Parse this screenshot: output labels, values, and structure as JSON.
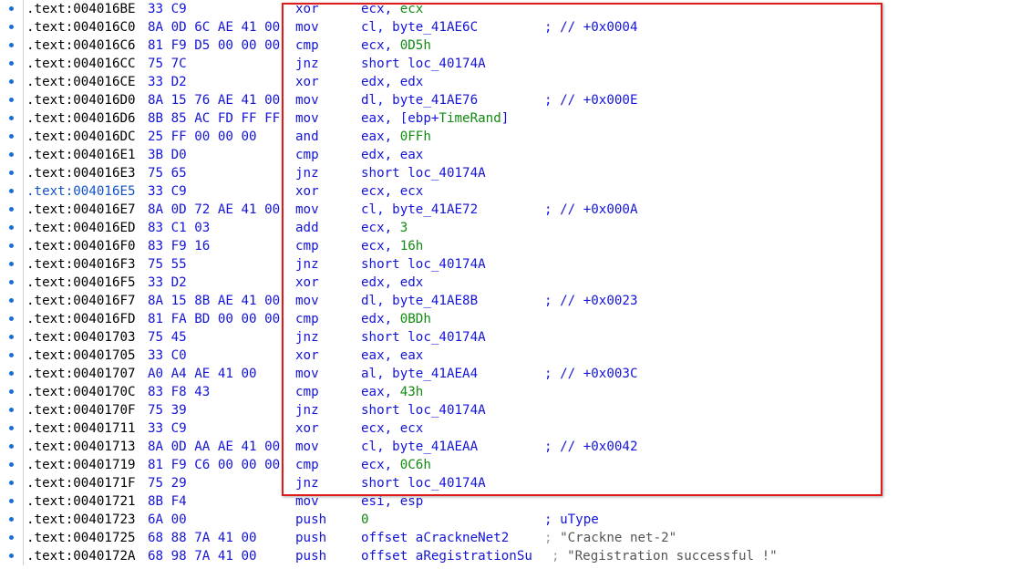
{
  "rows": [
    {
      "addr": ".text:004016BE",
      "bytes": "33 C9",
      "mnem": "xor",
      "op1": "ecx, ",
      "op2": "ecx",
      "cmt": ""
    },
    {
      "addr": ".text:004016C0",
      "bytes": "8A 0D 6C AE 41 00",
      "mnem": "mov",
      "op1": "cl, byte_41AE6C",
      "op2": "",
      "cmt": "; // +0x0004"
    },
    {
      "addr": ".text:004016C6",
      "bytes": "81 F9 D5 00 00 00",
      "mnem": "cmp",
      "op1": "ecx, ",
      "op2": "0D5h",
      "cmt": ""
    },
    {
      "addr": ".text:004016CC",
      "bytes": "75 7C",
      "mnem": "jnz",
      "op1": "short loc_40174A",
      "op2": "",
      "cmt": ""
    },
    {
      "addr": ".text:004016CE",
      "bytes": "33 D2",
      "mnem": "xor",
      "op1": "edx, edx",
      "op2": "",
      "cmt": ""
    },
    {
      "addr": ".text:004016D0",
      "bytes": "8A 15 76 AE 41 00",
      "mnem": "mov",
      "op1": "dl, byte_41AE76",
      "op2": "",
      "cmt": "; // +0x000E"
    },
    {
      "addr": ".text:004016D6",
      "bytes": "8B 85 AC FD FF FF",
      "mnem": "mov",
      "op1": "eax, [ebp+",
      "op2": "TimeRand",
      "op3": "]",
      "cmt": ""
    },
    {
      "addr": ".text:004016DC",
      "bytes": "25 FF 00 00 00",
      "mnem": "and",
      "op1": "eax, ",
      "op2": "0FFh",
      "cmt": ""
    },
    {
      "addr": ".text:004016E1",
      "bytes": "3B D0",
      "mnem": "cmp",
      "op1": "edx, eax",
      "op2": "",
      "cmt": ""
    },
    {
      "addr": ".text:004016E3",
      "bytes": "75 65",
      "mnem": "jnz",
      "op1": "short loc_40174A",
      "op2": "",
      "cmt": ""
    },
    {
      "addr": ".text:004016E5",
      "bytes": "33 C9",
      "mnem": "xor",
      "op1": "ecx, ecx",
      "op2": "",
      "cmt": "",
      "alt": true
    },
    {
      "addr": ".text:004016E7",
      "bytes": "8A 0D 72 AE 41 00",
      "mnem": "mov",
      "op1": "cl, byte_41AE72",
      "op2": "",
      "cmt": "; // +0x000A"
    },
    {
      "addr": ".text:004016ED",
      "bytes": "83 C1 03",
      "mnem": "add",
      "op1": "ecx, ",
      "op2": "3",
      "cmt": ""
    },
    {
      "addr": ".text:004016F0",
      "bytes": "83 F9 16",
      "mnem": "cmp",
      "op1": "ecx, ",
      "op2": "16h",
      "cmt": ""
    },
    {
      "addr": ".text:004016F3",
      "bytes": "75 55",
      "mnem": "jnz",
      "op1": "short loc_40174A",
      "op2": "",
      "cmt": ""
    },
    {
      "addr": ".text:004016F5",
      "bytes": "33 D2",
      "mnem": "xor",
      "op1": "edx, edx",
      "op2": "",
      "cmt": ""
    },
    {
      "addr": ".text:004016F7",
      "bytes": "8A 15 8B AE 41 00",
      "mnem": "mov",
      "op1": "dl, byte_41AE8B",
      "op2": "",
      "cmt": "; // +0x0023"
    },
    {
      "addr": ".text:004016FD",
      "bytes": "81 FA BD 00 00 00",
      "mnem": "cmp",
      "op1": "edx, ",
      "op2": "0BDh",
      "cmt": ""
    },
    {
      "addr": ".text:00401703",
      "bytes": "75 45",
      "mnem": "jnz",
      "op1": "short loc_40174A",
      "op2": "",
      "cmt": ""
    },
    {
      "addr": ".text:00401705",
      "bytes": "33 C0",
      "mnem": "xor",
      "op1": "eax, eax",
      "op2": "",
      "cmt": ""
    },
    {
      "addr": ".text:00401707",
      "bytes": "A0 A4 AE 41 00",
      "mnem": "mov",
      "op1": "al, byte_41AEA4",
      "op2": "",
      "cmt": "; // +0x003C"
    },
    {
      "addr": ".text:0040170C",
      "bytes": "83 F8 43",
      "mnem": "cmp",
      "op1": "eax, ",
      "op2": "43h",
      "cmt": ""
    },
    {
      "addr": ".text:0040170F",
      "bytes": "75 39",
      "mnem": "jnz",
      "op1": "short loc_40174A",
      "op2": "",
      "cmt": ""
    },
    {
      "addr": ".text:00401711",
      "bytes": "33 C9",
      "mnem": "xor",
      "op1": "ecx, ecx",
      "op2": "",
      "cmt": ""
    },
    {
      "addr": ".text:00401713",
      "bytes": "8A 0D AA AE 41 00",
      "mnem": "mov",
      "op1": "cl, byte_41AEAA",
      "op2": "",
      "cmt": "; // +0x0042"
    },
    {
      "addr": ".text:00401719",
      "bytes": "81 F9 C6 00 00 00",
      "mnem": "cmp",
      "op1": "ecx, ",
      "op2": "0C6h",
      "cmt": ""
    },
    {
      "addr": ".text:0040171F",
      "bytes": "75 29",
      "mnem": "jnz",
      "op1": "short loc_40174A",
      "op2": "",
      "cmt": ""
    },
    {
      "addr": ".text:00401721",
      "bytes": "8B F4",
      "mnem": "mov",
      "op1": "esi, esp",
      "op2": "",
      "cmt": ""
    },
    {
      "addr": ".text:00401723",
      "bytes": "6A 00",
      "mnem": "push",
      "op1": "",
      "op2": "0",
      "cmt": "; uType"
    },
    {
      "addr": ".text:00401725",
      "bytes": "68 88 7A 41 00",
      "mnem": "push",
      "op1": "offset aCrackneNet2",
      "op2": "",
      "cmt": "; ",
      "cmt_str": "\"Crackne net-2\"",
      "cmt_gray": true
    },
    {
      "addr": ".text:0040172A",
      "bytes": "68 98 7A 41 00",
      "mnem": "push",
      "op1": "offset aRegistrationSu",
      "op2": "",
      "cmt": "; ",
      "cmt_str": "\"Registration successful !\"",
      "cmt_gray": true
    }
  ],
  "colors": {
    "highlight_border": "#e01b1b",
    "address": "#000000",
    "address_alt": "#1452c7",
    "code": "#1414d8",
    "immediate": "#118b11",
    "string": "#555555"
  }
}
